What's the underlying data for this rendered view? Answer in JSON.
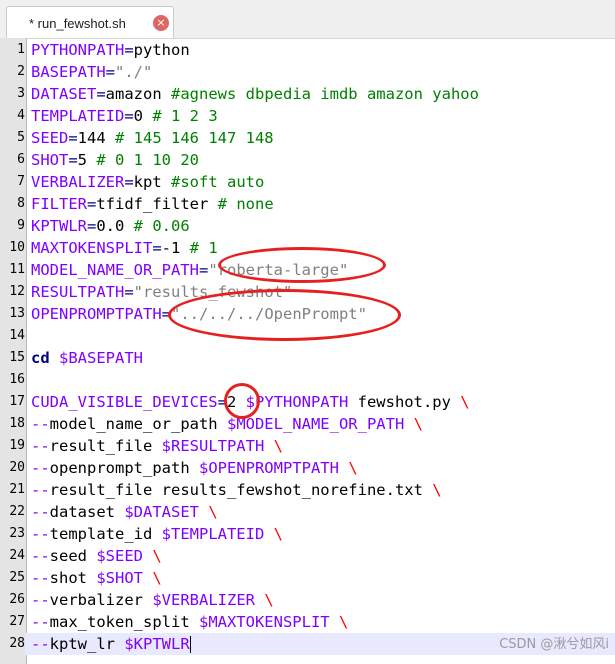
{
  "tab": {
    "title": "* run_fewshot.sh",
    "close_glyph": "×"
  },
  "lines": [
    {
      "n": "1",
      "t": [
        [
          "k",
          "PYTHONPATH"
        ],
        [
          "op",
          "="
        ],
        [
          "v",
          "python"
        ]
      ]
    },
    {
      "n": "2",
      "t": [
        [
          "k",
          "BASEPATH"
        ],
        [
          "op",
          "="
        ],
        [
          "s",
          "\"./\""
        ]
      ]
    },
    {
      "n": "3",
      "t": [
        [
          "k",
          "DATASET"
        ],
        [
          "op",
          "="
        ],
        [
          "v",
          "amazon "
        ],
        [
          "c",
          "#agnews dbpedia imdb amazon yahoo"
        ]
      ]
    },
    {
      "n": "4",
      "t": [
        [
          "k",
          "TEMPLATEID"
        ],
        [
          "op",
          "="
        ],
        [
          "v",
          "0 "
        ],
        [
          "c",
          "# 1 2 3"
        ]
      ]
    },
    {
      "n": "5",
      "t": [
        [
          "k",
          "SEED"
        ],
        [
          "op",
          "="
        ],
        [
          "v",
          "144 "
        ],
        [
          "c",
          "# 145 146 147 148"
        ]
      ]
    },
    {
      "n": "6",
      "t": [
        [
          "k",
          "SHOT"
        ],
        [
          "op",
          "="
        ],
        [
          "v",
          "5 "
        ],
        [
          "c",
          "# 0 1 10 20"
        ]
      ]
    },
    {
      "n": "7",
      "t": [
        [
          "k",
          "VERBALIZER"
        ],
        [
          "op",
          "="
        ],
        [
          "v",
          "kpt "
        ],
        [
          "c",
          "#soft auto"
        ]
      ]
    },
    {
      "n": "8",
      "t": [
        [
          "k",
          "FILTER"
        ],
        [
          "op",
          "="
        ],
        [
          "v",
          "tfidf_filter "
        ],
        [
          "c",
          "# none"
        ]
      ]
    },
    {
      "n": "9",
      "t": [
        [
          "k",
          "KPTWLR"
        ],
        [
          "op",
          "="
        ],
        [
          "v",
          "0.0 "
        ],
        [
          "c",
          "# 0.06"
        ]
      ]
    },
    {
      "n": "10",
      "t": [
        [
          "k",
          "MAXTOKENSPLIT"
        ],
        [
          "op",
          "="
        ],
        [
          "v",
          "-1 "
        ],
        [
          "c",
          "# 1"
        ]
      ]
    },
    {
      "n": "11",
      "t": [
        [
          "k",
          "MODEL_NAME_OR_PATH"
        ],
        [
          "op",
          "="
        ],
        [
          "s",
          "\"roberta-large\""
        ]
      ]
    },
    {
      "n": "12",
      "t": [
        [
          "k",
          "RESULTPATH"
        ],
        [
          "op",
          "="
        ],
        [
          "s",
          "\"results_fewshot\""
        ]
      ]
    },
    {
      "n": "13",
      "t": [
        [
          "k",
          "OPENPROMPTPATH"
        ],
        [
          "op",
          "="
        ],
        [
          "s",
          "\"../../../OpenPrompt\""
        ]
      ]
    },
    {
      "n": "14",
      "t": []
    },
    {
      "n": "15",
      "t": [
        [
          "b",
          "cd"
        ],
        [
          "v",
          " "
        ],
        [
          "dv",
          "$BASEPATH"
        ]
      ]
    },
    {
      "n": "16",
      "t": []
    },
    {
      "n": "17",
      "t": [
        [
          "k",
          "CUDA_VISIBLE_DEVICES"
        ],
        [
          "op",
          "="
        ],
        [
          "v",
          "2 "
        ],
        [
          "dv",
          "$PYTHONPATH"
        ],
        [
          "v",
          " fewshot.py "
        ],
        [
          "bs",
          "\\"
        ]
      ]
    },
    {
      "n": "18",
      "t": [
        [
          "flag",
          "--"
        ],
        [
          "v",
          "model_name_or_path "
        ],
        [
          "dv",
          "$MODEL_NAME_OR_PATH"
        ],
        [
          "v",
          " "
        ],
        [
          "bs",
          "\\"
        ]
      ]
    },
    {
      "n": "19",
      "t": [
        [
          "flag",
          "--"
        ],
        [
          "v",
          "result_file "
        ],
        [
          "dv",
          "$RESULTPATH"
        ],
        [
          "v",
          " "
        ],
        [
          "bs",
          "\\"
        ]
      ]
    },
    {
      "n": "20",
      "t": [
        [
          "flag",
          "--"
        ],
        [
          "v",
          "openprompt_path "
        ],
        [
          "dv",
          "$OPENPROMPTPATH"
        ],
        [
          "v",
          " "
        ],
        [
          "bs",
          "\\"
        ]
      ]
    },
    {
      "n": "21",
      "t": [
        [
          "flag",
          "--"
        ],
        [
          "v",
          "result_file results_fewshot_norefine.txt "
        ],
        [
          "bs",
          "\\"
        ]
      ]
    },
    {
      "n": "22",
      "t": [
        [
          "flag",
          "--"
        ],
        [
          "v",
          "dataset "
        ],
        [
          "dv",
          "$DATASET"
        ],
        [
          "v",
          " "
        ],
        [
          "bs",
          "\\"
        ]
      ]
    },
    {
      "n": "23",
      "t": [
        [
          "flag",
          "--"
        ],
        [
          "v",
          "template_id "
        ],
        [
          "dv",
          "$TEMPLATEID"
        ],
        [
          "v",
          " "
        ],
        [
          "bs",
          "\\"
        ]
      ]
    },
    {
      "n": "24",
      "t": [
        [
          "flag",
          "--"
        ],
        [
          "v",
          "seed "
        ],
        [
          "dv",
          "$SEED"
        ],
        [
          "v",
          " "
        ],
        [
          "bs",
          "\\"
        ]
      ]
    },
    {
      "n": "25",
      "t": [
        [
          "flag",
          "--"
        ],
        [
          "v",
          "shot "
        ],
        [
          "dv",
          "$SHOT"
        ],
        [
          "v",
          " "
        ],
        [
          "bs",
          "\\"
        ]
      ]
    },
    {
      "n": "26",
      "t": [
        [
          "flag",
          "--"
        ],
        [
          "v",
          "verbalizer "
        ],
        [
          "dv",
          "$VERBALIZER"
        ],
        [
          "v",
          " "
        ],
        [
          "bs",
          "\\"
        ]
      ]
    },
    {
      "n": "27",
      "t": [
        [
          "flag",
          "--"
        ],
        [
          "v",
          "max_token_split "
        ],
        [
          "dv",
          "$MAXTOKENSPLIT"
        ],
        [
          "v",
          " "
        ],
        [
          "bs",
          "\\"
        ]
      ]
    },
    {
      "n": "28",
      "t": [
        [
          "flag",
          "--"
        ],
        [
          "v",
          "kptw_lr "
        ],
        [
          "dv",
          "$KPTWLR"
        ]
      ]
    }
  ],
  "current_line": "28",
  "watermark": "CSDN @湫兮如风i",
  "colors": {
    "annotation": "#e62020",
    "current_line_bg": "#e8e8ff"
  }
}
